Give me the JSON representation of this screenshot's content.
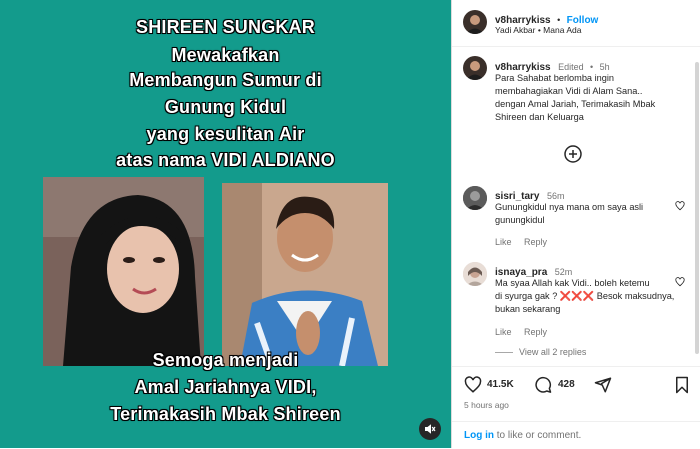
{
  "media": {
    "headline_lines": [
      "SHIREEN SUNGKAR",
      "Mewakafkan",
      "Membangun Sumur di",
      "Gunung Kidul",
      "yang kesulitan  Air",
      "atas nama VIDI ALDIANO"
    ],
    "footer_lines": [
      "Semoga menjadi",
      "Amal Jariahnya  VIDI,",
      "Terimakasih Mbak Shireen"
    ],
    "background_color": "#139b8c",
    "sound_icon": "speaker-muted-icon"
  },
  "header": {
    "username": "v8harrykiss",
    "separator": "•",
    "follow_label": "Follow",
    "subtitle": "Yadi Akbar • Mana Ada"
  },
  "caption": {
    "username": "v8harrykiss",
    "edited": "Edited",
    "dot": "•",
    "time": "5h",
    "text_lines": [
      "Para Sahabat berlomba ingin",
      "membahagiakan Vidi di Alam Sana..",
      "dengan Amal Jariah, Terimakasih Mbak",
      "Shireen dan Keluarga"
    ]
  },
  "load_more_icon": "plus-circle-icon",
  "comments": [
    {
      "username": "sisri_tary",
      "time": "56m",
      "text_lines": [
        "Gunungkidul nya mana om saya asli",
        "gunungkidul"
      ],
      "like_label": "Like",
      "reply_label": "Reply"
    },
    {
      "username": "isnaya_pra",
      "time": "52m",
      "text_lines": [
        "Ma syaa Allah kak Vidi.. boleh ketemu",
        "di syurga gak ? ❌❌❌ Besok maksudnya,",
        "bukan sekarang"
      ],
      "like_label": "Like",
      "reply_label": "Reply",
      "view_replies": "View all 2 replies"
    }
  ],
  "actions": {
    "like_count": "41.5K",
    "comment_count": "428",
    "post_time": "5 hours ago",
    "login_link": "Log in",
    "login_rest": " to like or comment."
  },
  "colors": {
    "accent_blue": "#0095f6",
    "teal": "#139b8c"
  }
}
